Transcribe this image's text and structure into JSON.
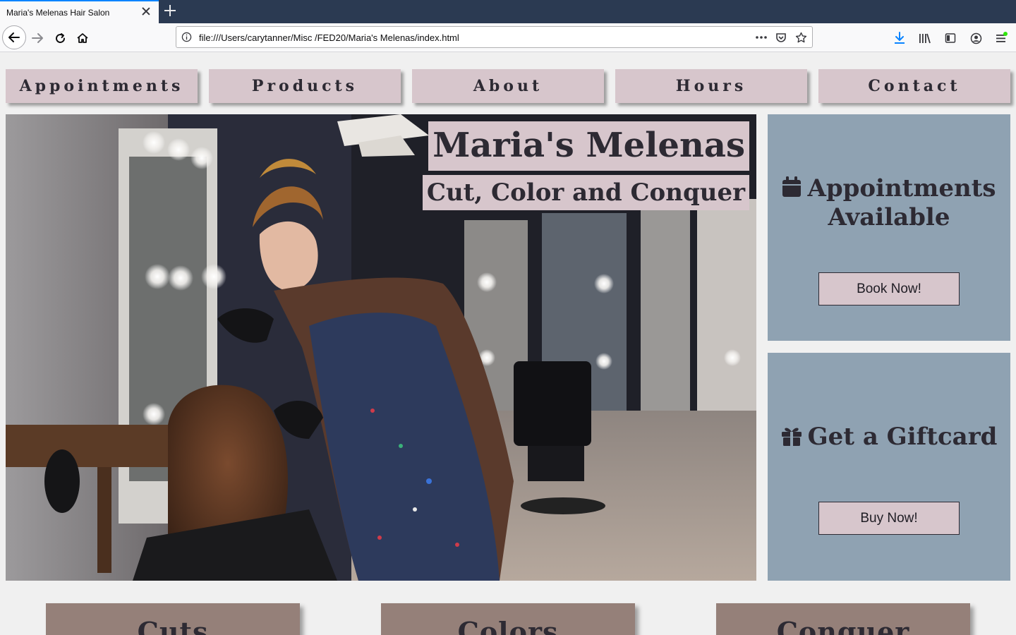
{
  "browser": {
    "tab_title": "Maria's Melenas Hair Salon",
    "url": "file:///Users/carytanner/Misc /FED20/Maria's Melenas/index.html"
  },
  "site_nav": [
    "Appointments",
    "Products",
    "About",
    "Hours",
    "Contact"
  ],
  "hero": {
    "title": "Maria's Melenas",
    "subtitle": "Cut, Color and Conquer"
  },
  "cards": {
    "appointments": {
      "heading": "Appointments Available",
      "icon": "calendar-icon",
      "button": "Book Now!"
    },
    "giftcard": {
      "heading": "Get a Giftcard",
      "icon": "gift-icon",
      "button": "Buy Now!"
    }
  },
  "services": [
    "Cuts",
    "Colors",
    "Conquer"
  ],
  "colors": {
    "nav_bg": "#d7c6cc",
    "card_bg": "#8fa2b2",
    "service_bg": "#958079",
    "text_dark": "#2d2a33"
  }
}
